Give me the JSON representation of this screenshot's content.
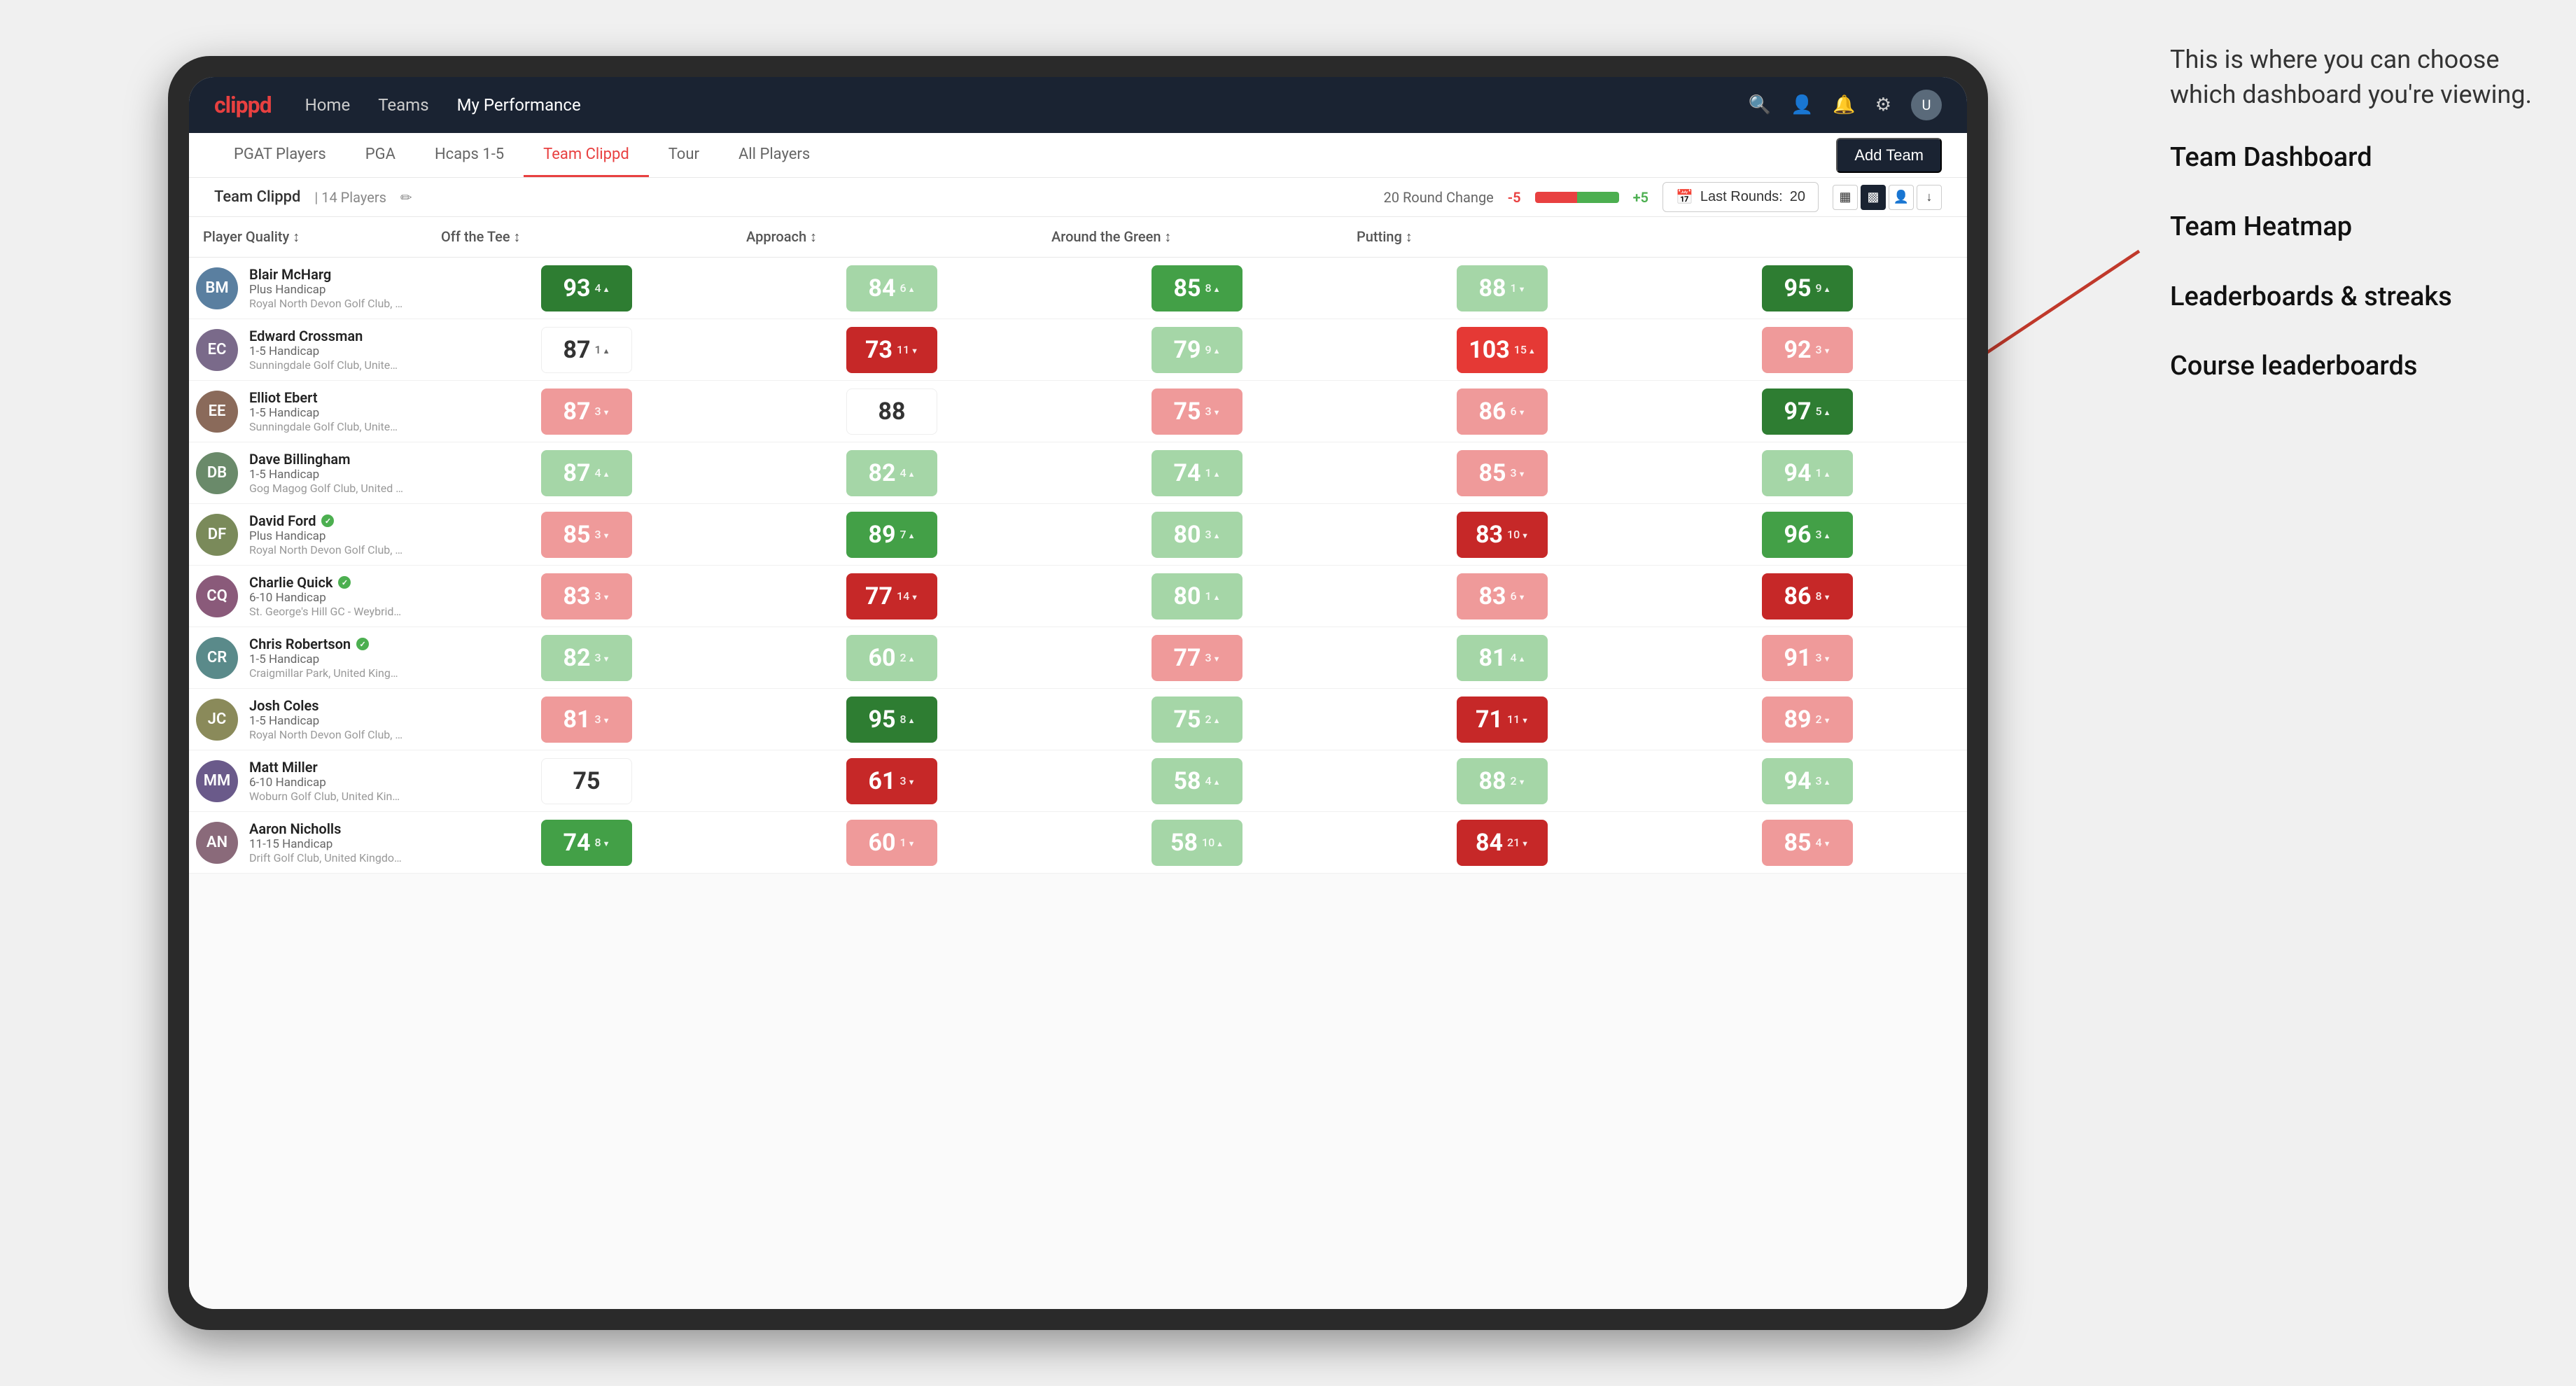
{
  "annotation": {
    "intro": "This is where you can choose which dashboard you're viewing.",
    "options": [
      "Team Dashboard",
      "Team Heatmap",
      "Leaderboards & streaks",
      "Course leaderboards"
    ]
  },
  "nav": {
    "logo": "clippd",
    "items": [
      "Home",
      "Teams",
      "My Performance"
    ],
    "active_item": "My Performance"
  },
  "sub_nav": {
    "tabs": [
      "PGAT Players",
      "PGA",
      "Hcaps 1-5",
      "Team Clippd",
      "Tour",
      "All Players"
    ],
    "active_tab": "Team Clippd",
    "add_team_label": "Add Team"
  },
  "team_header": {
    "team_name": "Team Clippd",
    "separator": "|",
    "player_count": "14 Players",
    "round_change_label": "20 Round Change",
    "round_change_neg": "-5",
    "round_change_pos": "+5",
    "last_rounds_label": "Last Rounds:",
    "last_rounds_value": "20"
  },
  "table": {
    "columns": [
      "Player Quality ↕",
      "Off the Tee ↕",
      "Approach ↕",
      "Around the Green ↕",
      "Putting ↕"
    ],
    "rows": [
      {
        "name": "Blair McHarg",
        "handicap": "Plus Handicap",
        "club": "Royal North Devon Golf Club, United Kingdom",
        "scores": [
          {
            "value": 93,
            "change": "+4",
            "dir": "up",
            "color": "green-strong"
          },
          {
            "value": 84,
            "change": "+6",
            "dir": "up",
            "color": "green-light"
          },
          {
            "value": 85,
            "change": "+8",
            "dir": "up",
            "color": "green-med"
          },
          {
            "value": 88,
            "change": "-1",
            "dir": "down",
            "color": "green-light"
          },
          {
            "value": 95,
            "change": "+9",
            "dir": "up",
            "color": "green-strong"
          }
        ]
      },
      {
        "name": "Edward Crossman",
        "handicap": "1-5 Handicap",
        "club": "Sunningdale Golf Club, United Kingdom",
        "scores": [
          {
            "value": 87,
            "change": "+1",
            "dir": "up",
            "color": "white"
          },
          {
            "value": 73,
            "change": "-11",
            "dir": "down",
            "color": "red-strong"
          },
          {
            "value": 79,
            "change": "+9",
            "dir": "up",
            "color": "green-light"
          },
          {
            "value": 103,
            "change": "+15",
            "dir": "up",
            "color": "red-med"
          },
          {
            "value": 92,
            "change": "-3",
            "dir": "down",
            "color": "red-light"
          }
        ]
      },
      {
        "name": "Elliot Ebert",
        "handicap": "1-5 Handicap",
        "club": "Sunningdale Golf Club, United Kingdom",
        "scores": [
          {
            "value": 87,
            "change": "-3",
            "dir": "down",
            "color": "red-light"
          },
          {
            "value": 88,
            "change": "",
            "dir": "",
            "color": "white"
          },
          {
            "value": 75,
            "change": "-3",
            "dir": "down",
            "color": "red-light"
          },
          {
            "value": 86,
            "change": "-6",
            "dir": "down",
            "color": "red-light"
          },
          {
            "value": 97,
            "change": "+5",
            "dir": "up",
            "color": "green-strong"
          }
        ]
      },
      {
        "name": "Dave Billingham",
        "handicap": "1-5 Handicap",
        "club": "Gog Magog Golf Club, United Kingdom",
        "scores": [
          {
            "value": 87,
            "change": "+4",
            "dir": "up",
            "color": "green-light"
          },
          {
            "value": 82,
            "change": "+4",
            "dir": "up",
            "color": "green-light"
          },
          {
            "value": 74,
            "change": "+1",
            "dir": "up",
            "color": "green-light"
          },
          {
            "value": 85,
            "change": "-3",
            "dir": "down",
            "color": "red-light"
          },
          {
            "value": 94,
            "change": "+1",
            "dir": "up",
            "color": "green-light"
          }
        ]
      },
      {
        "name": "David Ford",
        "handicap": "Plus Handicap",
        "club": "Royal North Devon Golf Club, United Kingdom",
        "verified": true,
        "scores": [
          {
            "value": 85,
            "change": "-3",
            "dir": "down",
            "color": "red-light"
          },
          {
            "value": 89,
            "change": "+7",
            "dir": "up",
            "color": "green-med"
          },
          {
            "value": 80,
            "change": "+3",
            "dir": "up",
            "color": "green-light"
          },
          {
            "value": 83,
            "change": "-10",
            "dir": "down",
            "color": "red-strong"
          },
          {
            "value": 96,
            "change": "+3",
            "dir": "up",
            "color": "green-med"
          }
        ]
      },
      {
        "name": "Charlie Quick",
        "handicap": "6-10 Handicap",
        "club": "St. George's Hill GC - Weybridge - Surrey, Uni...",
        "verified": true,
        "scores": [
          {
            "value": 83,
            "change": "-3",
            "dir": "down",
            "color": "red-light"
          },
          {
            "value": 77,
            "change": "-14",
            "dir": "down",
            "color": "red-strong"
          },
          {
            "value": 80,
            "change": "+1",
            "dir": "up",
            "color": "green-light"
          },
          {
            "value": 83,
            "change": "-6",
            "dir": "down",
            "color": "red-light"
          },
          {
            "value": 86,
            "change": "-8",
            "dir": "down",
            "color": "red-strong"
          }
        ]
      },
      {
        "name": "Chris Robertson",
        "handicap": "1-5 Handicap",
        "club": "Craigmillar Park, United Kingdom",
        "verified": true,
        "scores": [
          {
            "value": 82,
            "change": "-3",
            "dir": "down",
            "color": "green-light"
          },
          {
            "value": 60,
            "change": "+2",
            "dir": "up",
            "color": "green-light"
          },
          {
            "value": 77,
            "change": "-3",
            "dir": "down",
            "color": "red-light"
          },
          {
            "value": 81,
            "change": "+4",
            "dir": "up",
            "color": "green-light"
          },
          {
            "value": 91,
            "change": "-3",
            "dir": "down",
            "color": "red-light"
          }
        ]
      },
      {
        "name": "Josh Coles",
        "handicap": "1-5 Handicap",
        "club": "Royal North Devon Golf Club, United Kingdom",
        "scores": [
          {
            "value": 81,
            "change": "-3",
            "dir": "down",
            "color": "red-light"
          },
          {
            "value": 95,
            "change": "+8",
            "dir": "up",
            "color": "green-strong"
          },
          {
            "value": 75,
            "change": "+2",
            "dir": "up",
            "color": "green-light"
          },
          {
            "value": 71,
            "change": "-11",
            "dir": "down",
            "color": "red-strong"
          },
          {
            "value": 89,
            "change": "-2",
            "dir": "down",
            "color": "red-light"
          }
        ]
      },
      {
        "name": "Matt Miller",
        "handicap": "6-10 Handicap",
        "club": "Woburn Golf Club, United Kingdom",
        "scores": [
          {
            "value": 75,
            "change": "",
            "dir": "",
            "color": "white"
          },
          {
            "value": 61,
            "change": "-3",
            "dir": "down",
            "color": "red-strong"
          },
          {
            "value": 58,
            "change": "+4",
            "dir": "up",
            "color": "green-light"
          },
          {
            "value": 88,
            "change": "-2",
            "dir": "down",
            "color": "green-light"
          },
          {
            "value": 94,
            "change": "+3",
            "dir": "up",
            "color": "green-light"
          }
        ]
      },
      {
        "name": "Aaron Nicholls",
        "handicap": "11-15 Handicap",
        "club": "Drift Golf Club, United Kingdom",
        "scores": [
          {
            "value": 74,
            "change": "-8",
            "dir": "down",
            "color": "green-med"
          },
          {
            "value": 60,
            "change": "-1",
            "dir": "down",
            "color": "red-light"
          },
          {
            "value": 58,
            "change": "+10",
            "dir": "up",
            "color": "green-light"
          },
          {
            "value": 84,
            "change": "-21",
            "dir": "down",
            "color": "red-strong"
          },
          {
            "value": 85,
            "change": "-4",
            "dir": "down",
            "color": "red-light"
          }
        ]
      }
    ]
  }
}
